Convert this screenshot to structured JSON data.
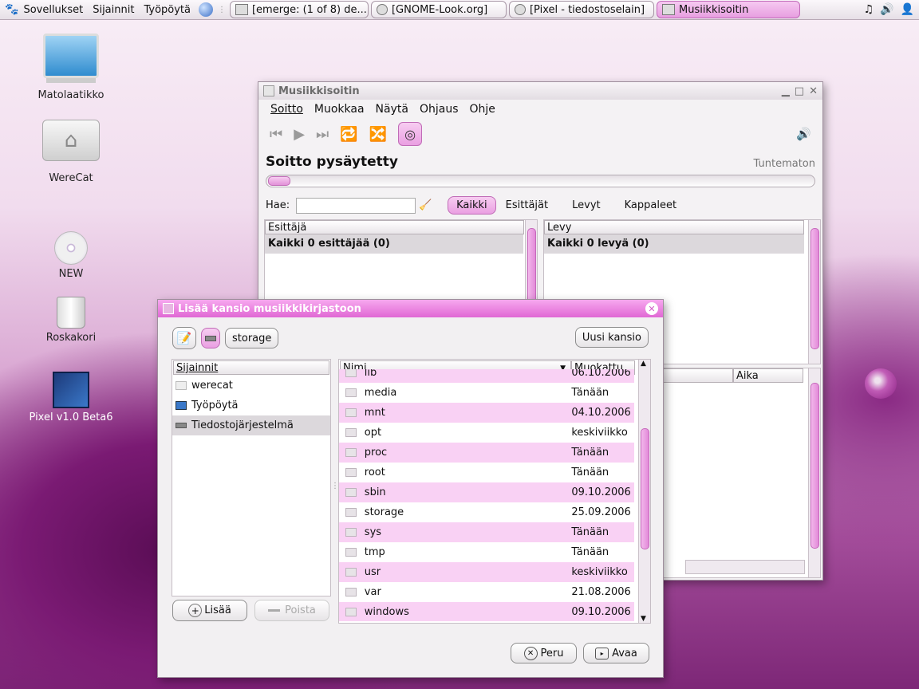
{
  "panel": {
    "menus": [
      "Sovellukset",
      "Sijainnit",
      "Työpöytä"
    ],
    "tasks": [
      {
        "label": "[emerge: (1 of 8) de...",
        "active": false
      },
      {
        "label": "[GNOME-Look.org]",
        "active": false
      },
      {
        "label": "[Pixel - tiedostoselain]",
        "active": false
      },
      {
        "label": "Musiikkisoitin",
        "active": true
      }
    ]
  },
  "desktop_icons": [
    {
      "label": "Matolaatikko",
      "icon": "computer-icon"
    },
    {
      "label": "WereCat",
      "icon": "home-folder-icon"
    },
    {
      "label": "NEW",
      "icon": "cdrom-icon"
    },
    {
      "label": "Roskakori",
      "icon": "trash-icon"
    },
    {
      "label": "Pixel v1.0 Beta6",
      "icon": "pixel-app-icon"
    }
  ],
  "player": {
    "title": "Musiikkisoitin",
    "menu": [
      "Soitto",
      "Muokkaa",
      "Näytä",
      "Ohjaus",
      "Ohje"
    ],
    "status": "Soitto pysäytetty",
    "track_info": "Tuntematon",
    "progress": 0.0,
    "search_label": "Hae:",
    "search_value": "",
    "tabs": [
      "Kaikki",
      "Esittäjät",
      "Levyt",
      "Kappaleet"
    ],
    "active_tab": "Kaikki",
    "artist_header": "Esittäjä",
    "artist_row": "Kaikki 0 esittäjää (0)",
    "album_header": "Levy",
    "album_row": "Kaikki 0 levyä (0)",
    "time_header": "Aika"
  },
  "dialog": {
    "title": "Lisää kansio musiikkikirjastoon",
    "path_button": "storage",
    "new_folder": "Uusi kansio",
    "places_header": "Sijainnit",
    "places": [
      "werecat",
      "Työpöytä",
      "Tiedostojärjestelmä"
    ],
    "selected_place": "Tiedostojärjestelmä",
    "add_button": "Lisää",
    "remove_button": "Poista",
    "name_header": "Nimi",
    "modified_header": "Muokattu",
    "files": [
      {
        "name": "lib",
        "date": "06.10.2006"
      },
      {
        "name": "media",
        "date": "Tänään"
      },
      {
        "name": "mnt",
        "date": "04.10.2006"
      },
      {
        "name": "opt",
        "date": "keskiviikko"
      },
      {
        "name": "proc",
        "date": "Tänään"
      },
      {
        "name": "root",
        "date": "Tänään"
      },
      {
        "name": "sbin",
        "date": "09.10.2006"
      },
      {
        "name": "storage",
        "date": "25.09.2006"
      },
      {
        "name": "sys",
        "date": "Tänään"
      },
      {
        "name": "tmp",
        "date": "Tänään"
      },
      {
        "name": "usr",
        "date": "keskiviikko"
      },
      {
        "name": "var",
        "date": "21.08.2006"
      },
      {
        "name": "windows",
        "date": "09.10.2006"
      }
    ],
    "cancel_button": "Peru",
    "open_button": "Avaa"
  }
}
